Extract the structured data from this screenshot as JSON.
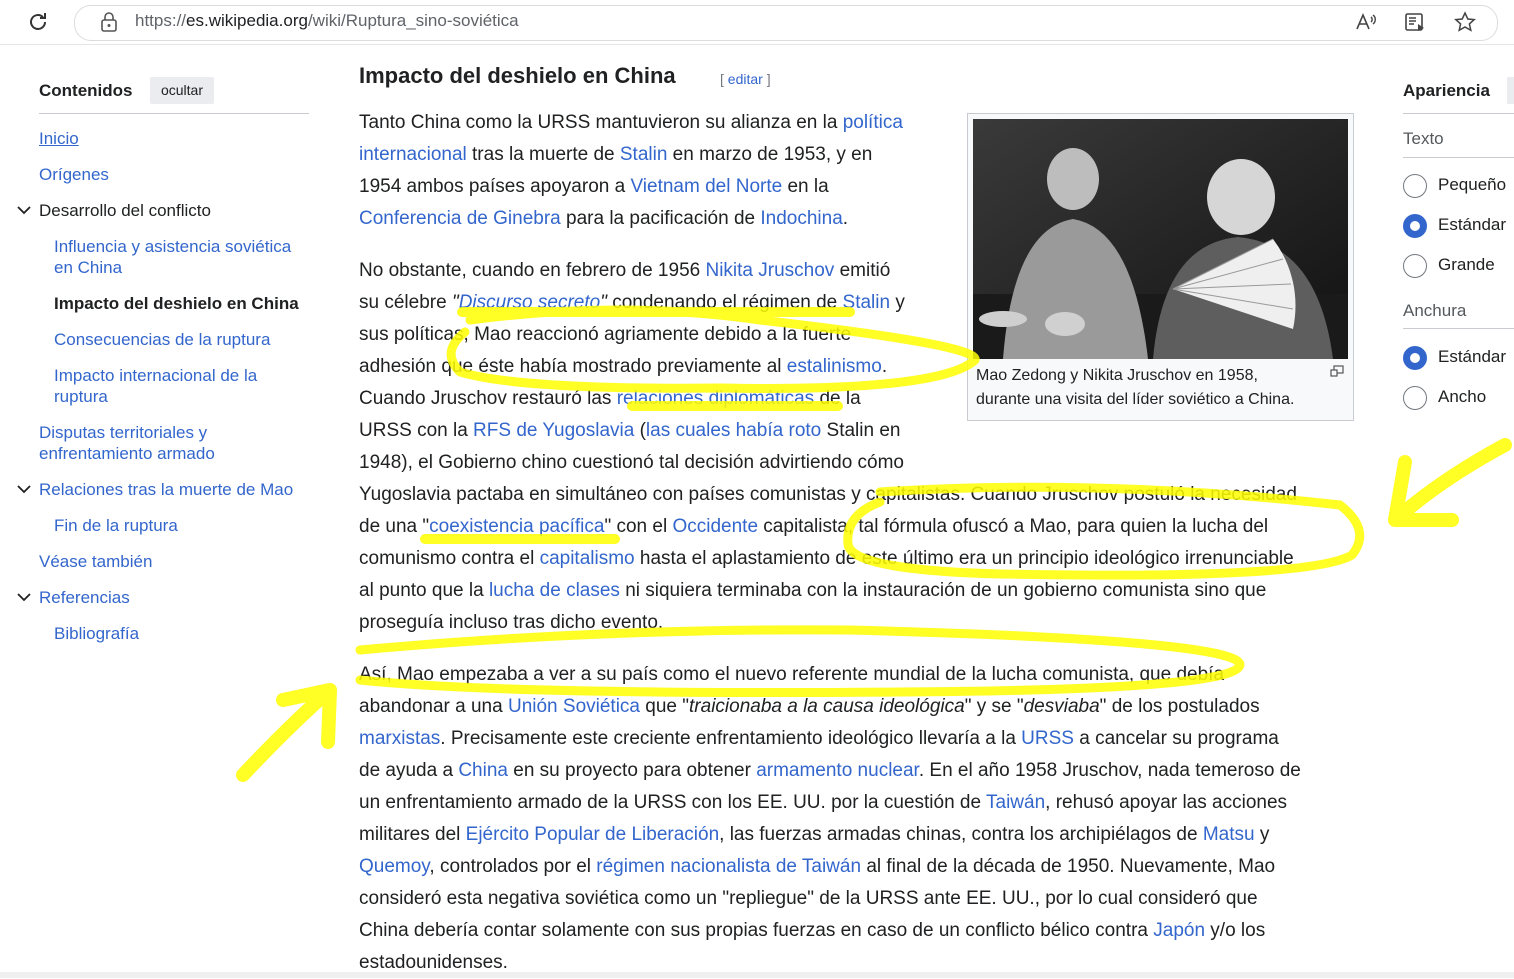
{
  "browser": {
    "url_prefix": "https://",
    "url_domain": "es.wikipedia.org",
    "url_path": "/wiki/Ruptura_sino-soviética"
  },
  "toc": {
    "title": "Contenidos",
    "hide_label": "ocultar",
    "items": [
      {
        "label": "Inicio"
      },
      {
        "label": "Orígenes"
      },
      {
        "label": "Desarrollo del conflicto"
      },
      {
        "label_1": "Influencia y asistencia soviética",
        "label_2": "en China"
      },
      {
        "label": "Impacto del deshielo en China"
      },
      {
        "label": "Consecuencias de la ruptura"
      },
      {
        "label_1": "Impacto internacional de la",
        "label_2": "ruptura"
      },
      {
        "label_1": "Disputas territoriales y",
        "label_2": "enfrentamiento armado"
      },
      {
        "label": "Relaciones tras la muerte de Mao"
      },
      {
        "label": "Fin de la ruptura"
      },
      {
        "label": "Véase también"
      },
      {
        "label": "Referencias"
      },
      {
        "label": "Bibliografía"
      }
    ]
  },
  "article": {
    "heading": "Impacto del deshielo en China",
    "edit_open": "[ ",
    "edit_label": "editar",
    "edit_close": " ]",
    "p1": [
      [
        "Tanto China como la URSS mantuvieron su alianza en la ",
        "política"
      ],
      [
        "internacional",
        " tras la muerte de ",
        "Stalin",
        " en marzo de 1953, y en"
      ],
      [
        "1954 ambos países apoyaron a ",
        "Vietnam del Norte",
        " en la"
      ],
      [
        "Conferencia de Ginebra",
        " para la pacificación de ",
        "Indochina",
        "."
      ]
    ],
    "p2": [
      [
        "No obstante, cuando en febrero de 1956 ",
        "Nikita Jruschov",
        " emitió"
      ],
      [
        "su célebre ",
        "\"",
        "Discurso secreto",
        "\"",
        " condenando el régimen de ",
        "Stalin",
        " y"
      ],
      [
        "sus políticas, Mao reaccionó agriamente debido a la fuerte"
      ],
      [
        "adhesión que éste había mostrado previamente al ",
        "estalinismo",
        "."
      ],
      [
        "Cuando Jruschov restauró las ",
        "relaciones diplomáticas",
        " de la"
      ],
      [
        "URSS con la ",
        "RFS de Yugoslavia",
        " (",
        "las cuales había roto",
        " Stalin en"
      ],
      [
        "1948), el Gobierno chino cuestionó tal decisión advirtiendo cómo"
      ],
      [
        "Yugoslavia pactaba en simultáneo con países comunistas y capitalistas. Cuando Jruschov postuló la necesidad"
      ],
      [
        "de una \"",
        "coexistencia pacífica",
        "\" con el ",
        "Occidente",
        " capitalista, tal fórmula ofuscó a Mao, para quien la lucha del"
      ],
      [
        "comunismo contra el ",
        "capitalismo",
        " hasta el aplastamiento de este último era un principio ideológico irrenunciable"
      ],
      [
        "al punto que la ",
        "lucha de clases",
        " ni siquiera terminaba con la instauración de un gobierno comunista sino que"
      ],
      [
        "proseguía incluso tras dicho evento."
      ]
    ],
    "p3": [
      [
        "Así, Mao empezaba a ver a su país como el nuevo referente mundial de la lucha comunista, que debía"
      ],
      [
        "abandonar a una ",
        "Unión Soviética",
        " que \"",
        "traicionaba a la causa ideológica",
        "\" y se \"",
        "desviaba",
        "\" de los postulados"
      ],
      [
        "marxistas",
        ". Precisamente este creciente enfrentamiento ideológico llevaría a la ",
        "URSS",
        " a cancelar su programa"
      ],
      [
        "de ayuda a ",
        "China",
        " en su proyecto para obtener ",
        "armamento nuclear",
        ". En el año 1958 Jruschov, nada temeroso de"
      ],
      [
        "un enfrentamiento armado de la URSS con los EE. UU. por la cuestión de ",
        "Taiwán",
        ", rehusó apoyar las acciones"
      ],
      [
        "militares del ",
        "Ejército Popular de Liberación",
        ", las fuerzas armadas chinas, contra los archipiélagos de ",
        "Matsu",
        " y"
      ],
      [
        "Quemoy",
        ", controlados por el ",
        "régimen nacionalista de Taiwán",
        " al final de la década de 1950. Nuevamente, Mao"
      ],
      [
        "consideró esta negativa soviética como un \"repliegue\" de la URSS ante EE. UU., por lo cual consideró que"
      ],
      [
        "China debería contar solamente con sus propias fuerzas en caso de un conflicto bélico contra ",
        "Japón",
        " y/o los"
      ],
      [
        "estadounidenses."
      ]
    ],
    "figure": {
      "caption_1": "Mao Zedong y Nikita Jruschov en 1958,",
      "caption_2": "durante una visita del líder soviético a China."
    }
  },
  "appearance": {
    "title": "Apariencia",
    "text_label": "Texto",
    "text_options": [
      "Pequeño",
      "Estándar",
      "Grande"
    ],
    "text_selected": "Estándar",
    "width_label": "Anchura",
    "width_options": [
      "Estándar",
      "Ancho"
    ],
    "width_selected": "Estándar"
  },
  "colors": {
    "link": "#3366cc",
    "text": "#202122",
    "highlight": "#ffff00",
    "radio_selected": "#3366cc"
  }
}
